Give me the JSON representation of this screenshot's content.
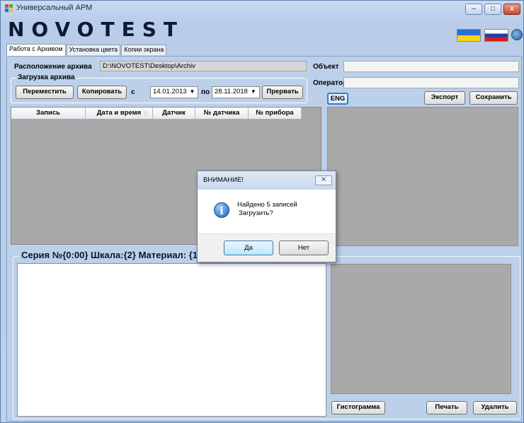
{
  "window": {
    "title": "Универсальный АРМ",
    "logo_text": "NOVOTEST",
    "controls": [
      "–",
      "□",
      "x"
    ]
  },
  "tabs": [
    {
      "label": "Работа с Архивом",
      "active": true
    },
    {
      "label": "Установка цвета",
      "active": false
    },
    {
      "label": "Копии экрана",
      "active": false
    }
  ],
  "archive": {
    "location_label": "Расположение архива",
    "location_value": "D:\\NOVOTEST\\Desktop\\Archiv",
    "load_group_label": "Загрузка архива",
    "move_button": "Переместить",
    "copy_button": "Копировать",
    "from_label": "с",
    "from_date": "14.01.2013",
    "to_label": "по",
    "to_date": "28.11.2018",
    "stop_button": "Прервать"
  },
  "right_panel": {
    "object_label": "Объект",
    "object_value": "",
    "operator_label": "Оператор",
    "operator_value": "",
    "eng_button": "ENG",
    "export_button": "Экспорт",
    "save_button": "Сохранить"
  },
  "grid": {
    "columns": [
      "Запись",
      "Дата и время",
      "Датчик",
      "№ датчика",
      "№ прибора"
    ],
    "sort_indicator": "▽"
  },
  "series_label": "Серия №{0:00} Шкала:{2} Материал: {1}",
  "bottom_buttons": {
    "histogram": "Гистограмма",
    "print": "Печать",
    "delete": "Удалить"
  },
  "dialog": {
    "title": "ВНИМАНИЕ!",
    "close": "✕",
    "message_line1": "Найдено 5 записей",
    "message_line2": "Загрузить?",
    "yes_button": "Да",
    "no_button": "Нет",
    "icon": "info-icon"
  },
  "flags": [
    "ukraine-flag-icon",
    "russia-flag-icon",
    "globe-icon"
  ],
  "colors": {
    "window_bg": "#bcd0ea",
    "panel_grey": "#a9a9a9",
    "accent_blue": "#3a78d8"
  }
}
